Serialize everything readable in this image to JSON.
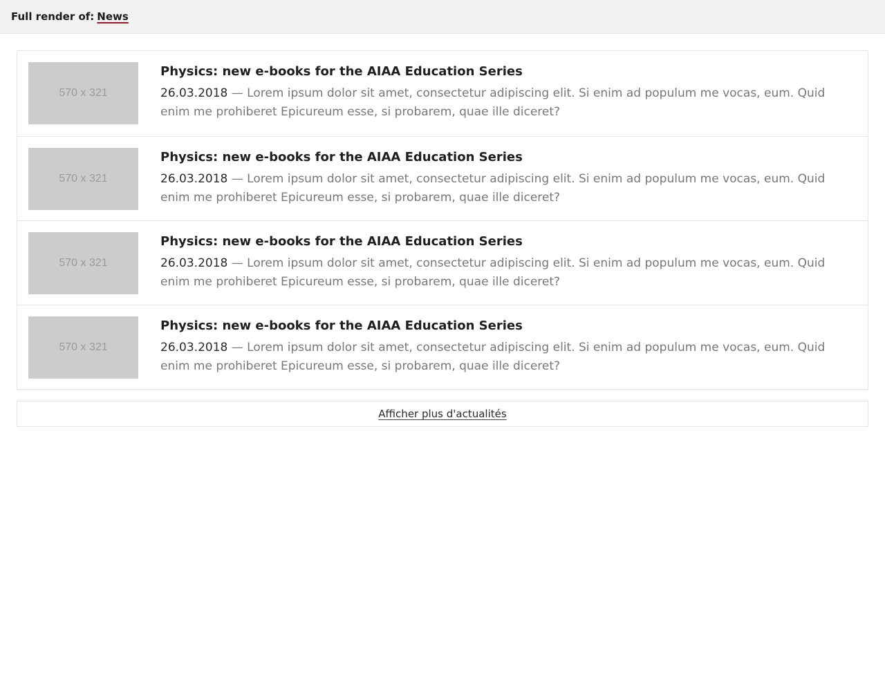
{
  "topbar": {
    "label": "Full render of:",
    "link": "News"
  },
  "news": {
    "items": [
      {
        "thumb": "570 x 321",
        "title": "Physics: new e-books for the AIAA Education Series",
        "date": "26.03.2018",
        "separator": "—",
        "summary": "Lorem ipsum dolor sit amet, consectetur adipiscing elit. Si enim ad populum me vocas, eum. Quid enim me prohiberet Epicureum esse, si probarem, quae ille diceret?"
      },
      {
        "thumb": "570 x 321",
        "title": "Physics: new e-books for the AIAA Education Series",
        "date": "26.03.2018",
        "separator": "—",
        "summary": "Lorem ipsum dolor sit amet, consectetur adipiscing elit. Si enim ad populum me vocas, eum. Quid enim me prohiberet Epicureum esse, si probarem, quae ille diceret?"
      },
      {
        "thumb": "570 x 321",
        "title": "Physics: new e-books for the AIAA Education Series",
        "date": "26.03.2018",
        "separator": "—",
        "summary": "Lorem ipsum dolor sit amet, consectetur adipiscing elit. Si enim ad populum me vocas, eum. Quid enim me prohiberet Epicureum esse, si probarem, quae ille diceret?"
      },
      {
        "thumb": "570 x 321",
        "title": "Physics: new e-books for the AIAA Education Series",
        "date": "26.03.2018",
        "separator": "—",
        "summary": "Lorem ipsum dolor sit amet, consectetur adipiscing elit. Si enim ad populum me vocas, eum. Quid enim me prohiberet Epicureum esse, si probarem, quae ille diceret?"
      }
    ],
    "more_label": "Afficher plus d'actualités"
  },
  "colors": {
    "accent_underline": "#a0152a",
    "placeholder_bg": "#cccccc",
    "topbar_bg": "#f2f2f3"
  }
}
